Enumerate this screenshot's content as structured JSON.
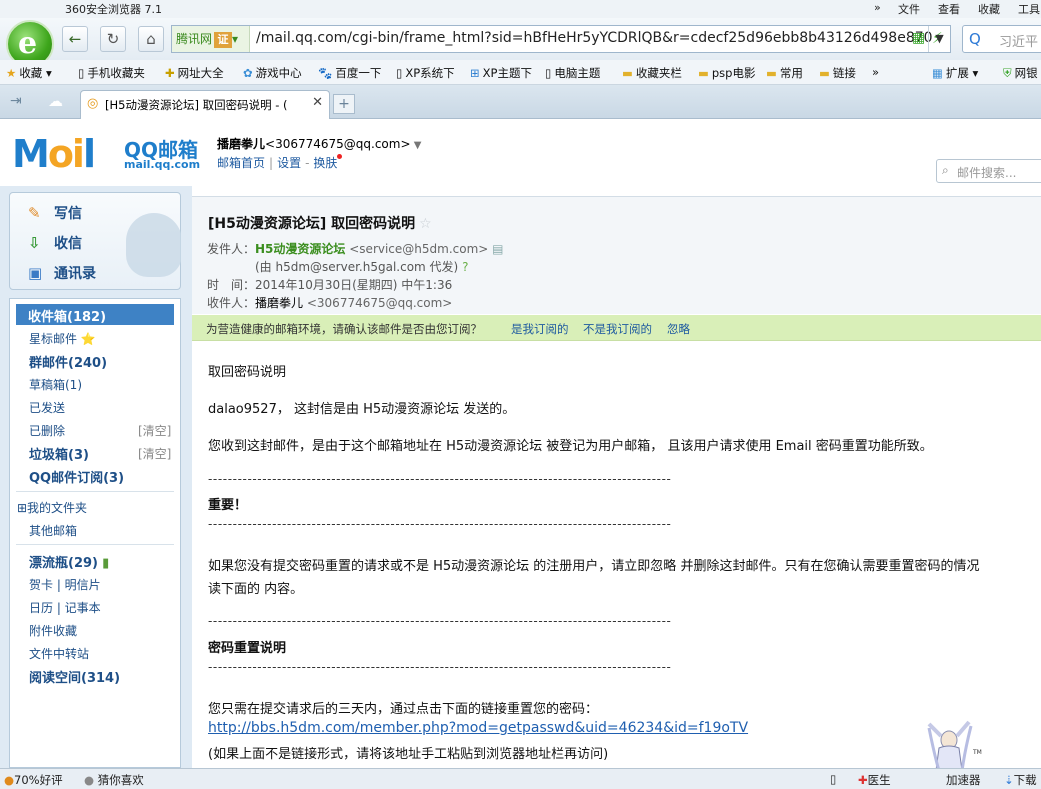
{
  "browser": {
    "app_title": "360安全浏览器 7.1",
    "menu": [
      "文件",
      "查看",
      "收藏",
      "工具"
    ],
    "address_prefix": "腾讯网",
    "address_badge": "证",
    "address_url": "/mail.qq.com/cgi-bin/frame_html?sid=hBfHeHr5yYCDRlQB&r=cdecf25d96ebb8b43126d498e870",
    "search_placeholder": "习近平",
    "favorites": [
      "收藏",
      "手机收藏夹",
      "网址大全",
      "游戏中心",
      "百度一下",
      "XP系统下",
      "XP主题下",
      "电脑主题",
      "收藏夹栏",
      "psp电影",
      "常用",
      "链接",
      "»",
      "扩展",
      "网银"
    ],
    "tab_title": "[H5动漫资源论坛] 取回密码说明 - (",
    "accent_color": "#3e82c5"
  },
  "mail": {
    "brand": "QQ邮箱",
    "domain": "mail.qq.com",
    "user_name": "播磨拳儿",
    "user_email": "<306774675@qq.com>",
    "link_home": "邮箱首页",
    "link_settings": "设置",
    "link_skin": "换肤",
    "search_placeholder": "邮件搜索..."
  },
  "sidebar": {
    "compose": "写信",
    "receive": "收信",
    "contacts": "通讯录",
    "inbox": "收件箱(182)",
    "items": [
      {
        "label": "星标邮件 ⭐"
      },
      {
        "label": "群邮件(240)"
      },
      {
        "label": "草稿箱(1)"
      },
      {
        "label": "已发送"
      },
      {
        "label": "已删除"
      },
      {
        "label": "垃圾箱(3)"
      },
      {
        "label": "QQ邮件订阅(3)"
      },
      {
        "label": "⊞我的文件夹"
      },
      {
        "label": "其他邮箱"
      },
      {
        "label": "漂流瓶(29)"
      },
      {
        "label": "贺卡 | 明信片"
      },
      {
        "label": "日历 | 记事本"
      },
      {
        "label": "附件收藏"
      },
      {
        "label": "文件中转站"
      },
      {
        "label": "阅读空间(314)"
      }
    ],
    "clear_label": "[清空]"
  },
  "message": {
    "subject": "[H5动漫资源论坛] 取回密码说明",
    "from_label": "发件人：",
    "from_name": "H5动漫资源论坛",
    "from_addr": "<service@h5dm.com>",
    "via": "(由 h5dm@server.h5gal.com 代发)",
    "time_label": "时　间：",
    "time": "2014年10月30日(星期四) 中午1:36",
    "to_label": "收件人：",
    "to_name": "播磨拳儿",
    "to_addr": "<306774675@qq.com>",
    "spam_prompt": "为营造健康的邮箱环境，请确认该邮件是否由您订阅？",
    "spam_yes": "是我订阅的",
    "spam_no": "不是我订阅的",
    "spam_ignore": "忽略",
    "body_title": "取回密码说明",
    "body_greeting": "dalao9527， 这封信是由 H5动漫资源论坛 发送的。",
    "body_reason": "您收到这封邮件，是由于这个邮箱地址在 H5动漫资源论坛 被登记为用户邮箱， 且该用户请求使用 Email 密码重置功能所致。",
    "dashes": "----------------------------------------------------------------------------------------------",
    "important": "重要！",
    "warning_1": "如果您没有提交密码重置的请求或不是 H5动漫资源论坛 的注册用户，请立即忽略 并删除这封邮件。只有在您确认需要重置密码的情况",
    "warning_2": "读下面的 内容。",
    "reset_heading": "密码重置说明",
    "reset_instruction": "您只需在提交请求后的三天内，通过点击下面的链接重置您的密码：",
    "reset_link": "http://bbs.h5dm.com/member.php?mod=getpasswd&uid=46234&id=f19oTV",
    "reset_note": "(如果上面不是链接形式，请将该地址手工粘贴到浏览器地址栏再访问)"
  },
  "status": {
    "rating": "70%好评",
    "guess": "猜你喜欢",
    "doctor": "医生",
    "speed": "加速器",
    "download": "下载"
  }
}
